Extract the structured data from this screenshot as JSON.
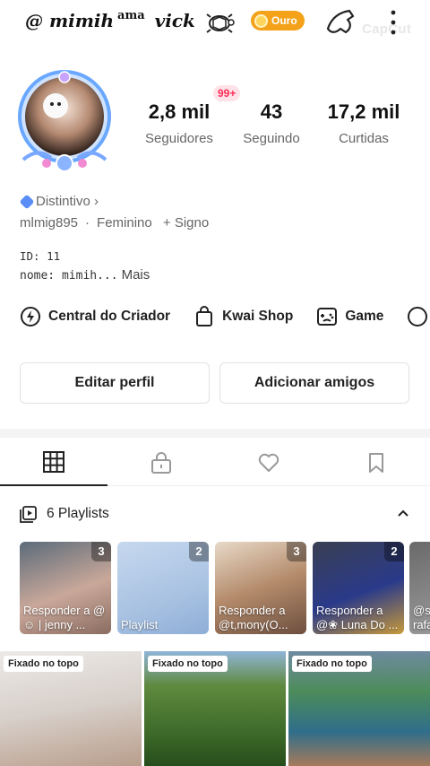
{
  "header": {
    "username_at": "@",
    "username_part1": "mimih",
    "username_sup": "ama",
    "username_part2": "vick",
    "level_badge": "Ouro",
    "watermark": "CapCut"
  },
  "profile": {
    "notification_badge": "99+",
    "stats": [
      {
        "value": "2,8 mil",
        "label": "Seguidores"
      },
      {
        "value": "43",
        "label": "Seguindo"
      },
      {
        "value": "17,2 mil",
        "label": "Curtidas"
      }
    ],
    "distintivo": "Distintivo ›",
    "handle": "mlmig895",
    "gender": "Feminino",
    "sign": "+ Signo",
    "id_line": "ID: 11",
    "name_line": "nome: mimih...",
    "more": "Mais"
  },
  "shortcuts": [
    {
      "label": "Central do Criador",
      "icon": "lightning-icon"
    },
    {
      "label": "Kwai Shop",
      "icon": "shopping-bag-icon"
    },
    {
      "label": "Game",
      "icon": "gamepad-icon"
    }
  ],
  "buttons": {
    "edit": "Editar perfil",
    "add_friends": "Adicionar amigos"
  },
  "tabs": [
    "grid-icon",
    "lock-icon",
    "heart-icon",
    "bookmark-icon"
  ],
  "playlists": {
    "title": "6 Playlists",
    "items": [
      {
        "count": "3",
        "caption": "Responder a @☺ | jenny ..."
      },
      {
        "count": "2",
        "caption": "Playlist"
      },
      {
        "count": "3",
        "caption": "Responder a @t,mony(O..."
      },
      {
        "count": "2",
        "caption": "Responder a @❀ Luna Do ..."
      },
      {
        "count": "",
        "caption": "@s rafa"
      }
    ]
  },
  "videos": {
    "pinned_label": "Fixado no topo",
    "items": [
      "Fixado no topo",
      "Fixado no topo",
      "Fixado no topo"
    ]
  },
  "colors": {
    "accent_red": "#fe2c55",
    "gold": "#f3a21a",
    "badge_blue": "#5b8df6"
  }
}
